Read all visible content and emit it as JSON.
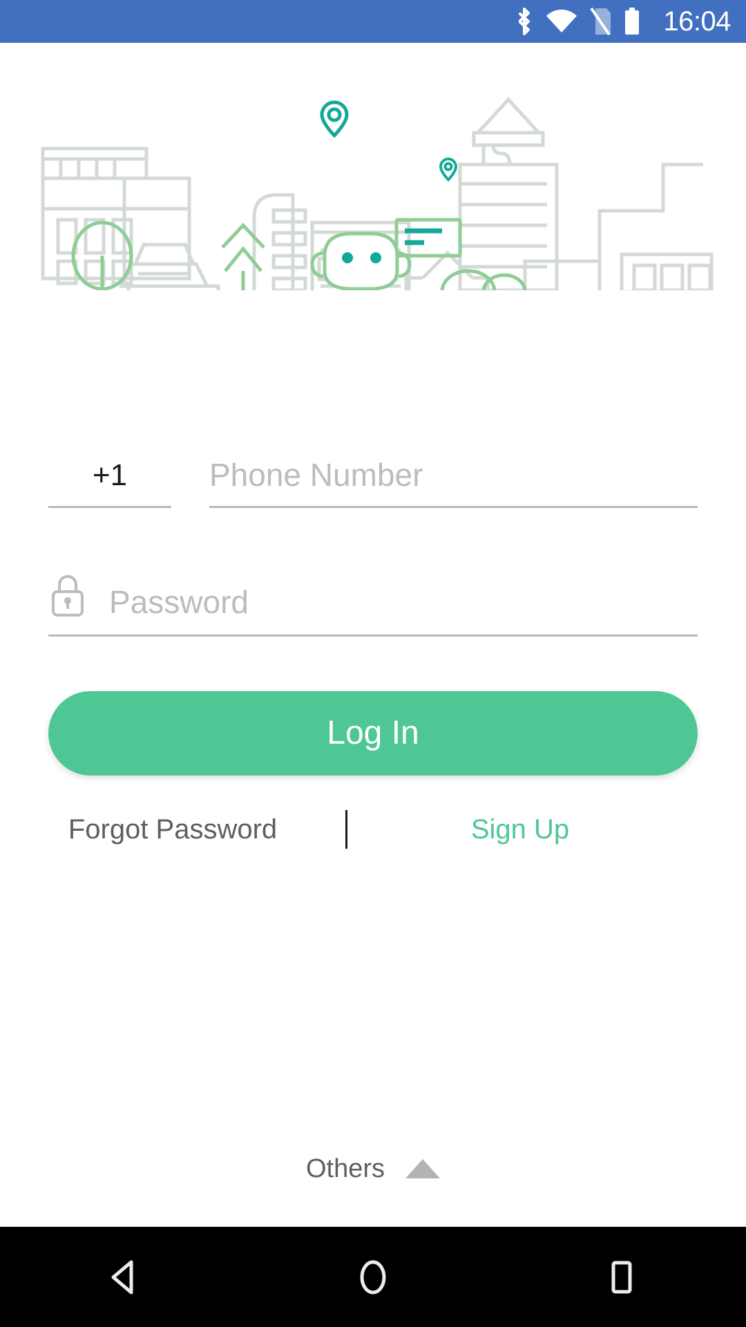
{
  "status_bar": {
    "background_color": "#4270c0",
    "time": "16:04",
    "icons": [
      {
        "name": "bluetooth-icon",
        "label": "Bluetooth"
      },
      {
        "name": "wifi-icon",
        "label": "Wi-Fi"
      },
      {
        "name": "no-sim-icon",
        "label": "No SIM"
      },
      {
        "name": "battery-icon",
        "label": "Battery"
      }
    ]
  },
  "illustration": {
    "name": "city-skyline-illustration",
    "outline_color": "#d3dad5",
    "green_color": "#8fcc96",
    "teal_color": "#12a89a",
    "elements": [
      "buildings",
      "tree",
      "pine-tree",
      "map-pin-large",
      "map-pin-small",
      "billboard",
      "robot-mascot",
      "bushes",
      "ground-line"
    ]
  },
  "form": {
    "country_code": {
      "value": "+1",
      "name": "country-code-field"
    },
    "phone": {
      "value": "",
      "placeholder": "Phone Number"
    },
    "password": {
      "value": "",
      "placeholder": "Password",
      "icon": "lock-icon"
    }
  },
  "actions": {
    "login_label": "Log In",
    "login_color": "#4ec794",
    "forgot_label": "Forgot Password",
    "signup_label": "Sign Up",
    "signup_color": "#4ec794",
    "others_label": "Others",
    "others_caret": "caret-up-icon"
  },
  "nav_bar": {
    "background_color": "#000000",
    "buttons": [
      {
        "name": "nav-back-button",
        "label": "Back"
      },
      {
        "name": "nav-home-button",
        "label": "Home"
      },
      {
        "name": "nav-recents-button",
        "label": "Recents"
      }
    ]
  }
}
